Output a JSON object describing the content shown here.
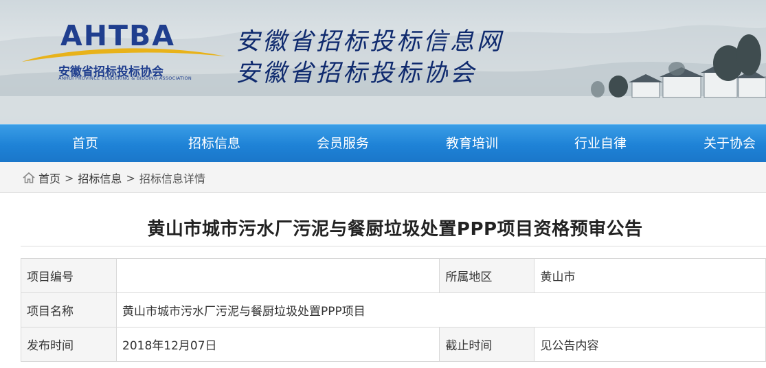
{
  "brand": {
    "logo_word": "AHTBA",
    "logo_cn": "安徽省招标投标协会",
    "logo_en": "ANHUI PROVINCE TENDERING & BIDDING ASSOCIATION",
    "title_line1": "安徽省招标投标信息网",
    "title_line2": "安徽省招标投标协会",
    "colors": {
      "brand_blue": "#1f3e8e",
      "accent_gold": "#e8b21a",
      "nav_blue": "#1e82d6"
    }
  },
  "nav": {
    "items": [
      {
        "label": "首页"
      },
      {
        "label": "招标信息"
      },
      {
        "label": "会员服务"
      },
      {
        "label": "教育培训"
      },
      {
        "label": "行业自律"
      },
      {
        "label": "关于协会"
      }
    ]
  },
  "breadcrumb": {
    "icon": "home-icon",
    "items": [
      {
        "label": "首页"
      },
      {
        "label": "招标信息"
      },
      {
        "label": "招标信息详情"
      }
    ],
    "separator": ">"
  },
  "article": {
    "title": "黄山市城市污水厂污泥与餐厨垃圾处置PPP项目资格预审公告",
    "table": {
      "project_no_label": "项目编号",
      "project_no_value": "",
      "region_label": "所属地区",
      "region_value": "黄山市",
      "project_name_label": "项目名称",
      "project_name_value": "黄山市城市污水厂污泥与餐厨垃圾处置PPP项目",
      "publish_time_label": "发布时间",
      "publish_time_value": "2018年12月07日",
      "deadline_label": "截止时间",
      "deadline_value": "见公告内容"
    }
  }
}
